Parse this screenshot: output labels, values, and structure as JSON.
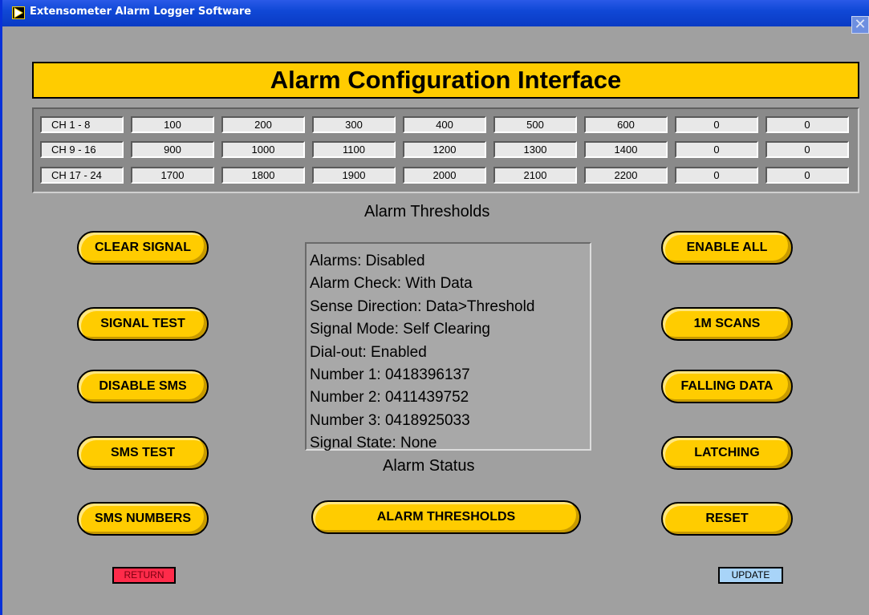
{
  "window": {
    "title": "Extensometer Alarm Logger Software",
    "close_glyph": "✕"
  },
  "banner": {
    "title": "Alarm Configuration Interface"
  },
  "thresholds_table": {
    "rows": [
      {
        "label": "CH  1 - 8",
        "values": [
          "100",
          "200",
          "300",
          "400",
          "500",
          "600",
          "0",
          "0"
        ]
      },
      {
        "label": "CH  9 - 16",
        "values": [
          "900",
          "1000",
          "1100",
          "1200",
          "1300",
          "1400",
          "0",
          "0"
        ]
      },
      {
        "label": "CH 17 - 24",
        "values": [
          "1700",
          "1800",
          "1900",
          "2000",
          "2100",
          "2200",
          "0",
          "0"
        ]
      }
    ],
    "caption": "Alarm Thresholds"
  },
  "left_buttons": [
    {
      "label": "CLEAR SIGNAL"
    },
    {
      "label": "SIGNAL TEST"
    },
    {
      "label": "DISABLE SMS"
    },
    {
      "label": "SMS TEST"
    },
    {
      "label": "SMS NUMBERS"
    }
  ],
  "right_buttons": [
    {
      "label": "ENABLE ALL"
    },
    {
      "label": "1M SCANS"
    },
    {
      "label": "FALLING DATA"
    },
    {
      "label": "LATCHING"
    },
    {
      "label": "RESET"
    }
  ],
  "status": {
    "lines": [
      "Alarms: Disabled",
      "Alarm Check: With Data",
      "Sense Direction: Data>Threshold",
      "Signal Mode: Self Clearing",
      "Dial-out: Enabled",
      "Number 1: 0418396137",
      "Number 2: 0411439752",
      "Number 3: 0418925033",
      "Signal State: None"
    ],
    "caption": "Alarm Status"
  },
  "center_button": {
    "label": "ALARM THRESHOLDS"
  },
  "return_button": {
    "label": "RETURN"
  },
  "update_button": {
    "label": "UPDATE"
  },
  "colors": {
    "accent": "#ffcc00",
    "panel": "#a0a0a0",
    "title_bar": "#0a3bc4",
    "return": "#ff2b4a",
    "update": "#a8d4f8"
  },
  "icons": {
    "app": "labview-run-arrow-icon",
    "close": "close-icon"
  }
}
